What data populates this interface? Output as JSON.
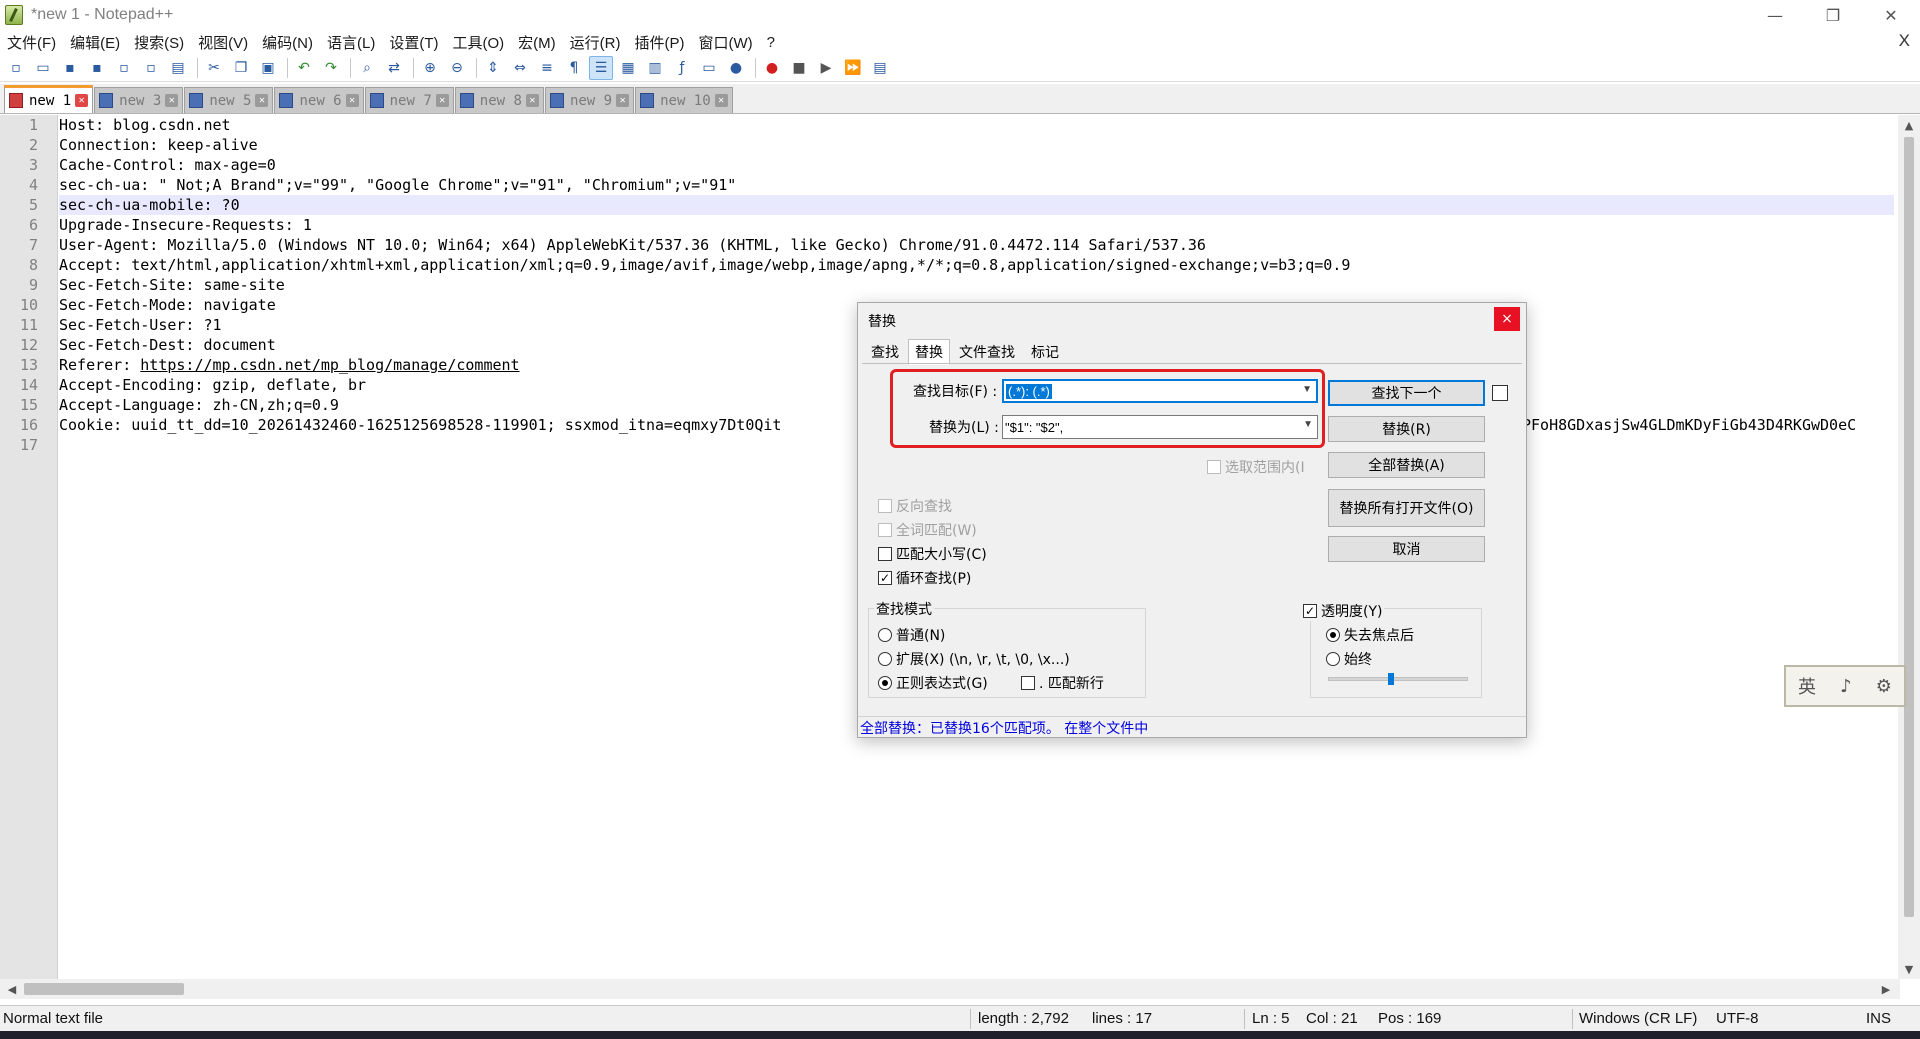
{
  "window": {
    "title": "*new 1 - Notepad++",
    "minimize": "—",
    "maximize": "❐",
    "close": "✕"
  },
  "menu": {
    "items": [
      "文件(F)",
      "编辑(E)",
      "搜索(S)",
      "视图(V)",
      "编码(N)",
      "语言(L)",
      "设置(T)",
      "工具(O)",
      "宏(M)",
      "运行(R)",
      "插件(P)",
      "窗口(W)",
      "?"
    ],
    "close": "X"
  },
  "tabs": [
    {
      "label": "new 1",
      "active": true
    },
    {
      "label": "new 3"
    },
    {
      "label": "new 5"
    },
    {
      "label": "new 6"
    },
    {
      "label": "new 7"
    },
    {
      "label": "new 8"
    },
    {
      "label": "new 9"
    },
    {
      "label": "new 10"
    }
  ],
  "editor": {
    "lines": [
      "Host: blog.csdn.net",
      "Connection: keep-alive",
      "Cache-Control: max-age=0",
      "sec-ch-ua: \" Not;A Brand\";v=\"99\", \"Google Chrome\";v=\"91\", \"Chromium\";v=\"91\"",
      "sec-ch-ua-mobile: ?0",
      "Upgrade-Insecure-Requests: 1",
      "User-Agent: Mozilla/5.0 (Windows NT 10.0; Win64; x64) AppleWebKit/537.36 (KHTML, like Gecko) Chrome/91.0.4472.114 Safari/537.36",
      "Accept: text/html,application/xhtml+xml,application/xml;q=0.9,image/avif,image/webp,image/apng,*/*;q=0.8,application/signed-exchange;v=b3;q=0.9",
      "Sec-Fetch-Site: same-site",
      "Sec-Fetch-Mode: navigate",
      "Sec-Fetch-User: ?1",
      "Sec-Fetch-Dest: document",
      "Referer: https://mp.csdn.net/mp_blog/manage/comment",
      "Accept-Encoding: gzip, deflate, br",
      "Accept-Language: zh-CN,zh;q=0.9",
      "Cookie: uuid_tt_dd=10_20261432460-1625125698528-119901; ssxmod_itna=eqmxy7Dt0Qit",
      ""
    ],
    "line16_tail": "PFoH8GDxasjSw4GLDmKDyFiGb43D4RKGwD0eC",
    "current_line": 5
  },
  "dialog": {
    "title": "替换",
    "close": "×",
    "tabs": [
      "查找",
      "替换",
      "文件查找",
      "标记"
    ],
    "active_tab": 1,
    "find_label": "查找目标(F) :",
    "find_value": "(.*): (.*)",
    "replace_label": "替换为(L) :",
    "replace_value": "\"$1\": \"$2\",",
    "in_selection": "选取范围内(I",
    "buttons": {
      "find_next": "查找下一个",
      "replace": "替换(R)",
      "replace_all": "全部替换(A)",
      "replace_all_open": "替换所有打开文件(O)",
      "cancel": "取消"
    },
    "options": {
      "backward": "反向查找",
      "whole_word": "全词匹配(W)",
      "match_case": "匹配大小写(C)",
      "wrap": "循环查找(P)"
    },
    "search_mode": {
      "title": "查找模式",
      "normal": "普通(N)",
      "extended": "扩展(X) (\\n, \\r, \\t, \\0, \\x...)",
      "regex": "正则表达式(G)",
      "dot_newline": ". 匹配新行"
    },
    "transparency": {
      "title": "透明度(Y)",
      "on_lose_focus": "失去焦点后",
      "always": "始终",
      "level": 0.45
    },
    "status": "全部替换：已替换16个匹配项。 在整个文件中"
  },
  "ime": {
    "chars": [
      "英",
      "♪",
      "⚙"
    ]
  },
  "statusbar": {
    "file_type": "Normal text file",
    "length": "length : 2,792",
    "lines": "lines : 17",
    "ln": "Ln : 5",
    "col": "Col : 21",
    "pos": "Pos : 169",
    "eol": "Windows (CR LF)",
    "encoding": "UTF-8",
    "mode": "INS"
  }
}
